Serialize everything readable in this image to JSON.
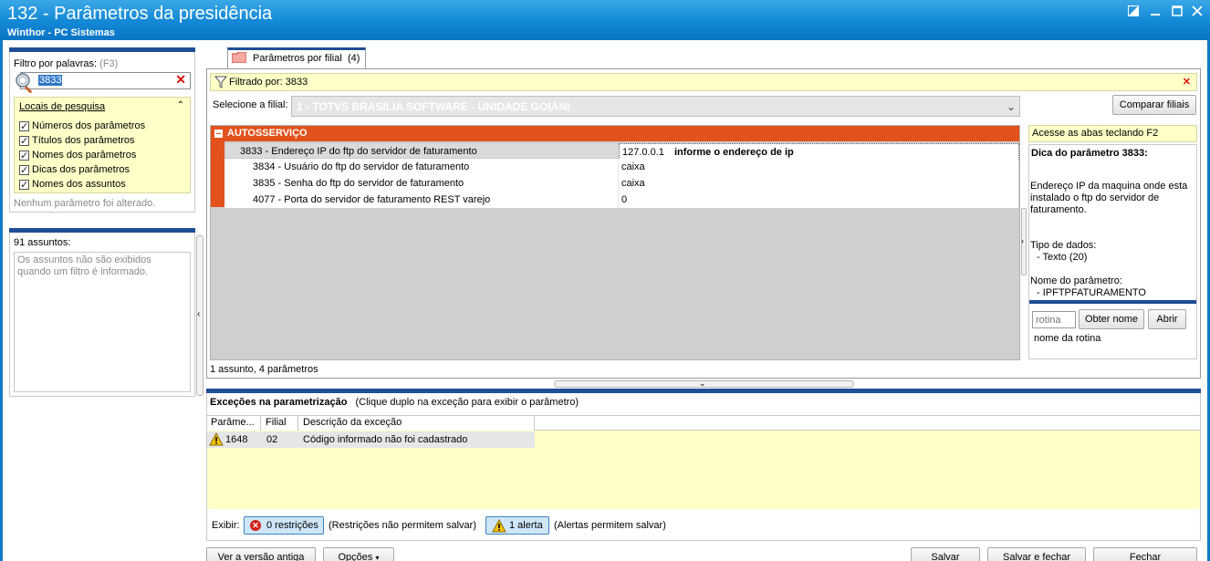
{
  "window": {
    "title": "132 - Parâmetros da presidência",
    "subtitle": "Winthor - PC Sistemas"
  },
  "filter": {
    "label": "Filtro por palavras:",
    "shortcut": "(F3)",
    "value": "3833"
  },
  "search_places": {
    "title": "Locais de pesquisa",
    "items": [
      {
        "label": "Números dos parâmetros",
        "checked": true
      },
      {
        "label": "Títulos dos parâmetros",
        "checked": true
      },
      {
        "label": "Nomes dos parâmetros",
        "checked": true
      },
      {
        "label": "Dicas dos parâmetros",
        "checked": true
      },
      {
        "label": "Nomes dos assuntos",
        "checked": true
      }
    ]
  },
  "changed_status": "Nenhum parâmetro foi alterado.",
  "subjects": {
    "label": "91 assuntos:",
    "note": "Os assuntos não são exibidos quando um filtro é informado."
  },
  "tab": {
    "label": "Parâmetros por filial",
    "count": "(4)"
  },
  "filtered_by": "Filtrado por: 3833",
  "branch": {
    "label": "Selecione a filial:",
    "value": "1 - TOTVS BRASILIA SOFTWARE - UNIDADE GOIANI",
    "compare_button": "Comparar filiais"
  },
  "grid": {
    "group": "AUTOSSERVIÇO",
    "rows": [
      {
        "param": "3833 - Endereço IP do ftp do servidor de faturamento",
        "value": "127.0.0.1",
        "hint": "informe o endereço de ip"
      },
      {
        "param": "3834 - Usuário do ftp do servidor de faturamento",
        "value": "caixa",
        "hint": ""
      },
      {
        "param": "3835 - Senha do ftp do servidor de faturamento",
        "value": "caixa",
        "hint": ""
      },
      {
        "param": "4077 - Porta do servidor de faturamento REST varejo",
        "value": "0",
        "hint": ""
      }
    ],
    "summary": "1 assunto, 4 parâmetros"
  },
  "tip": {
    "access": "Acesse as abas teclando F2",
    "title": "Dica do parâmetro 3833:",
    "body": "Endereço IP da maquina onde esta instalado o ftp do servidor de faturamento.",
    "type_label": "Tipo de dados:",
    "type_value": "- Texto (20)",
    "name_label": "Nome do parâmetro:",
    "name_value": "- IPFTPFATURAMENTO"
  },
  "routine": {
    "placeholder": "rotina",
    "get_name_button": "Obter nome",
    "open_button": "Abrir",
    "name_label": "nome da rotina"
  },
  "exceptions": {
    "title": "Exceções na parametrização",
    "hint": "(Clique duplo na exceção para exibir o parâmetro)",
    "columns": [
      "Parâme...",
      "Filial",
      "Descrição da exceção"
    ],
    "rows": [
      {
        "param": "1648",
        "branch": "02",
        "description": "Código informado não foi cadastrado"
      }
    ]
  },
  "show": {
    "label": "Exibir:",
    "restrictions_button": "0 restrições",
    "restrictions_note": "(Restrições não permitem salvar)",
    "alerts_button": "1 alerta",
    "alerts_note": "(Alertas permitem salvar)"
  },
  "footer": {
    "old_version": "Ver a versão antiga",
    "options": "Opções",
    "save": "Salvar",
    "save_close": "Salvar e fechar",
    "close": "Fechar"
  },
  "colors": {
    "title_bar": "#1288d6",
    "group_orange": "#e2521c",
    "panel_yellow": "#ffffc8",
    "header_navy": "#1f4e96"
  }
}
